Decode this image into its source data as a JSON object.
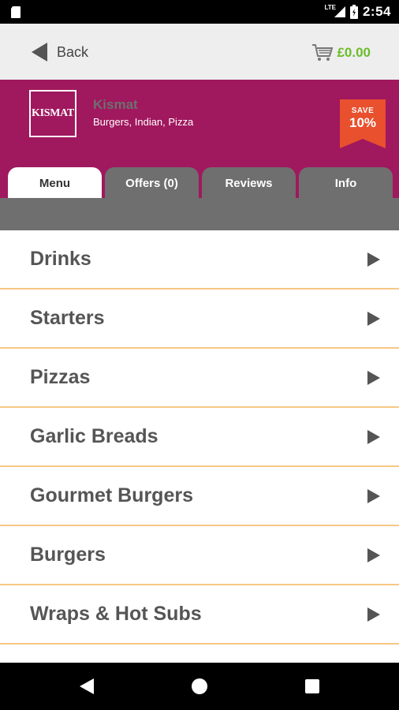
{
  "status_bar": {
    "time": "2:54",
    "network": "LTE",
    "icons": [
      "sd-card-icon",
      "signal-icon",
      "battery-icon"
    ]
  },
  "header": {
    "back_label": "Back",
    "cart_total": "£0.00"
  },
  "restaurant": {
    "logo_text": "KISMAT",
    "name": "Kismat",
    "cuisine": "Burgers, Indian, Pizza",
    "badge_small": "SAVE",
    "badge_pct": "10%"
  },
  "tabs": [
    {
      "label": "Menu",
      "active": true
    },
    {
      "label": "Offers (0)",
      "active": false
    },
    {
      "label": "Reviews",
      "active": false
    },
    {
      "label": "Info",
      "active": false
    }
  ],
  "menu": {
    "items": [
      {
        "label": "Drinks"
      },
      {
        "label": "Starters"
      },
      {
        "label": "Pizzas"
      },
      {
        "label": "Garlic Breads"
      },
      {
        "label": "Gourmet Burgers"
      },
      {
        "label": "Burgers"
      },
      {
        "label": "Wraps & Hot Subs"
      }
    ]
  },
  "colors": {
    "brand": "#a0185e",
    "tab_inactive": "#6f6f6f",
    "badge": "#e8502e",
    "cart_total": "#6cbd2c",
    "divider": "#f6c784"
  },
  "nav_bar": {
    "icons": [
      "nav-back-icon",
      "nav-home-icon",
      "nav-recents-icon"
    ]
  }
}
